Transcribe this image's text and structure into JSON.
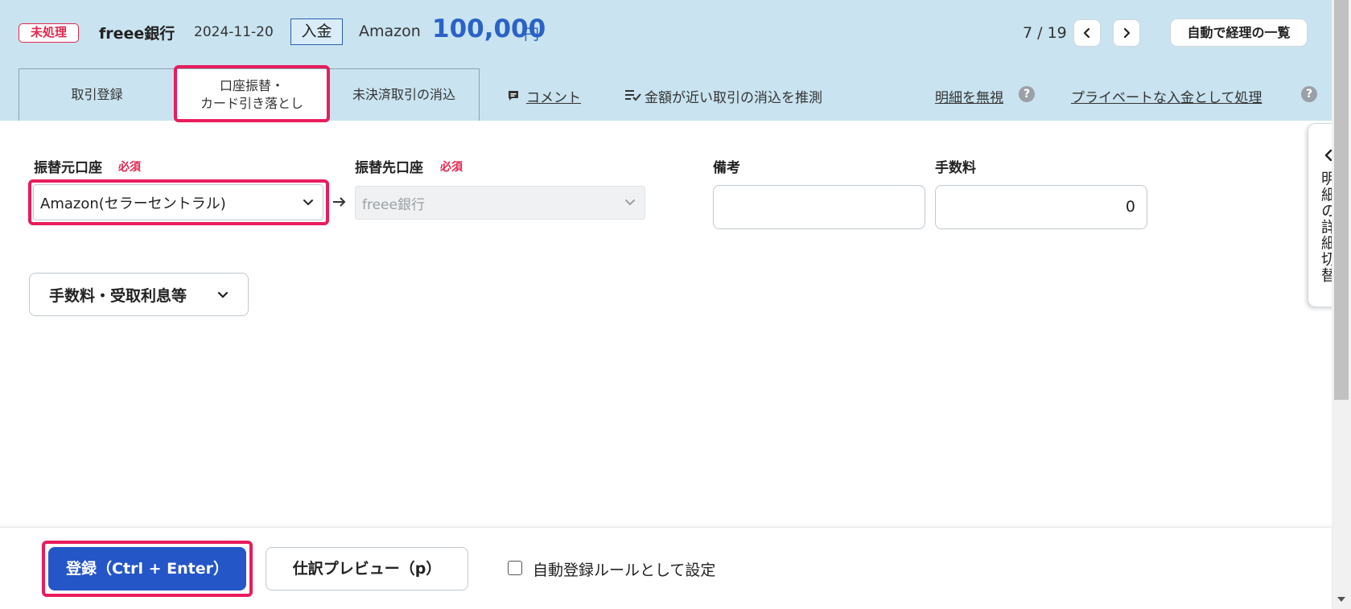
{
  "header": {
    "status_badge": "未処理",
    "bank_name": "freee銀行",
    "date": "2024-11-20",
    "type_badge": "入金",
    "partner": "Amazon",
    "amount": "100,000",
    "currency": "円",
    "pager": "7 / 19",
    "list_button": "自動で経理の一覧"
  },
  "tabs": [
    {
      "label": "取引登録"
    },
    {
      "label": "口座振替・\nカード引き落とし"
    },
    {
      "label": "未決済取引の消込"
    }
  ],
  "actions": {
    "comment": "コメント",
    "suggest": "金額が近い取引の消込を推測",
    "ignore": "明細を無視",
    "private": "プライベートな入金として処理"
  },
  "form": {
    "from_label": "振替元口座",
    "to_label": "振替先口座",
    "required": "必須",
    "from_value": "Amazon(セラーセントラル)",
    "to_value": "freee銀行",
    "memo_label": "備考",
    "memo_value": "",
    "fee_label": "手数料",
    "fee_value": "0",
    "accordion": "手数料・受取利息等"
  },
  "side_panel": {
    "label": "明細の詳細切替"
  },
  "footer": {
    "register": "登録（Ctrl + Enter）",
    "preview": "仕訳プレビュー（p）",
    "auto_rule": "自動登録ルールとして設定"
  },
  "colors": {
    "header_bg": "#c9e3f0",
    "accent_blue": "#2456c8",
    "amount_blue": "#2a62c5",
    "alert_red": "#e0284f",
    "highlight_pink": "#e81c5c"
  }
}
